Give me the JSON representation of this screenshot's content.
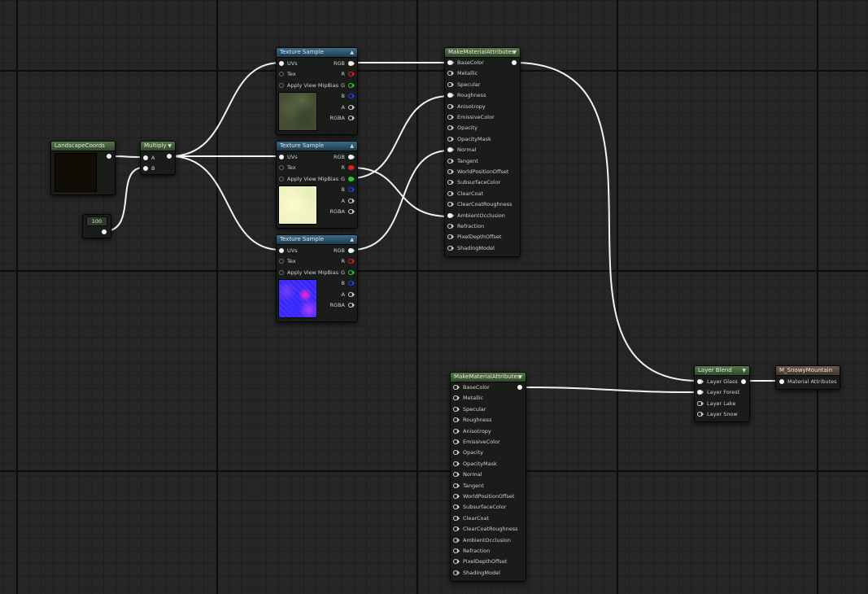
{
  "nodes": {
    "landscape_coords": {
      "title": "LandscapeCoords"
    },
    "constant": {
      "value": "100"
    },
    "multiply": {
      "title": "Multiply",
      "inputs": [
        "A",
        "B"
      ]
    },
    "texture_sample": {
      "title": "Texture Sample",
      "inputs": [
        "UVs",
        "Tex",
        "Apply View MipBias"
      ],
      "outputs": [
        "RGB",
        "R",
        "G",
        "B",
        "A",
        "RGBA"
      ],
      "output_colors": {
        "RGB": "#f2f2f2",
        "R": "#e02020",
        "G": "#20d020",
        "B": "#2040ff",
        "A": "#cfcfcf",
        "RGBA": "#cfcfcf"
      }
    },
    "make_material_attributes": {
      "title": "MakeMaterialAttributes",
      "inputs": [
        "BaseColor",
        "Metallic",
        "Specular",
        "Roughness",
        "Anisotropy",
        "EmissiveColor",
        "Opacity",
        "OpacityMask",
        "Normal",
        "Tangent",
        "WorldPositionOffset",
        "SubsurfaceColor",
        "ClearCoat",
        "ClearCoatRoughness",
        "AmbientOcclusion",
        "Refraction",
        "PixelDepthOffset",
        "ShadingModel"
      ]
    },
    "layer_blend": {
      "title": "Layer Blend",
      "inputs": [
        "Layer Glass",
        "Layer Forest",
        "Layer Lake",
        "Layer Snow"
      ]
    },
    "material_output": {
      "title": "M_SnowyMountain",
      "inputs": [
        "Material Attributes"
      ]
    }
  },
  "colors": {
    "canvas_bg": "#262626",
    "header_green": "#3f5e37",
    "header_blue": "#2a5470",
    "header_brown": "#55463a",
    "wire": "#f0f0f0"
  }
}
